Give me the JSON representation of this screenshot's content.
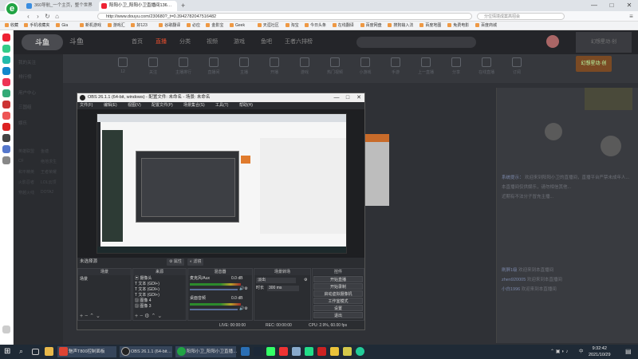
{
  "browser": {
    "tabs": [
      {
        "label": "360导航_一个主页，整个世界",
        "active": false
      },
      {
        "label": "阳阳小卫_阳阳小卫直播间136…",
        "active": true
      }
    ],
    "new_tab": "+",
    "url": "http://www.douyu.com/230680?_t=0.3942782047516482",
    "search_placeholder": "分位情境成案高招会",
    "window_controls": [
      "—",
      "□",
      "✕"
    ]
  },
  "bookmarks": [
    "收藏",
    "手机收藏夹",
    "Gia",
    "新机游戏",
    "游戏汇",
    "好123",
    "谷歌翻译",
    "必应",
    "金影宝",
    "Geek",
    "天涯社区",
    "淘宝",
    "今日头条",
    "在线翻译",
    "百度网盘",
    "搜狗输入法",
    "百度地图",
    "免费电影",
    "百度商城"
  ],
  "site": {
    "logo": "斗鱼",
    "logo2": "斗鱼",
    "nav": [
      "首页",
      "直播",
      "分类",
      "视频",
      "游戏",
      "鱼吧",
      "王者六排榜"
    ],
    "promo": "幻想星动·创",
    "left_nav": [
      "我的关注",
      "排行榜",
      "用户中心",
      "三国组",
      "娱乐",
      "鱼塘",
      "英雄联盟",
      "绝地求生",
      "CF",
      "王者荣耀",
      "和平精英",
      "LOL云顶",
      "火影忍者",
      "DOTA2",
      "穿越火线"
    ],
    "section_icons": [
      "12",
      "关注",
      "主播排行",
      "直播间",
      "主播",
      "开播",
      "游戏",
      "热门视频",
      "小游戏",
      "手游",
      "上一直播",
      "分享",
      "在线直播",
      "订阅"
    ],
    "chat": [
      {
        "user": "系统提示：",
        "text": "欢迎来到阳阳小卫的直播间，直播平台严禁未成年人..."
      },
      {
        "user": "",
        "text": "本直播间仅供娱乐，请勿相信其他..."
      },
      {
        "user": "",
        "text": "近期有不法分子冒充主播..."
      },
      {
        "user": "刷屏1级",
        "text": "欢迎来到本直播间"
      },
      {
        "user": "zhen920005",
        "text": "欢迎来到本直播间"
      },
      {
        "user": "小白1996",
        "text": "欢迎来到本直播间"
      }
    ]
  },
  "obs": {
    "title": "OBS 26.1.1 (64-bit, windows) - 配置文件: 未命名 - 场景: 未命名",
    "menu": [
      "文件(F)",
      "编辑(E)",
      "视图(V)",
      "配置文件(P)",
      "场景集合(S)",
      "工具(T)",
      "帮助(H)"
    ],
    "no_source": "未选择源",
    "props_btn": "属性",
    "filter_btn": "滤镜",
    "docks": {
      "scenes": {
        "title": "场景",
        "items": [
          "场景"
        ]
      },
      "sources": {
        "title": "来源",
        "items": [
          "摄像头",
          "文本 (GDI+)",
          "文本 (GDI+)",
          "文本 (GDI+)",
          "图像 4",
          "图像 3"
        ]
      },
      "mixer": {
        "title": "混音器",
        "tracks": [
          {
            "name": "麦克风/Aux",
            "db": "0.0 dB"
          },
          {
            "name": "桌面音频",
            "db": "0.0 dB"
          }
        ]
      },
      "transitions": {
        "title": "场景转场",
        "type": "淡出",
        "duration_label": "时长",
        "duration": "300 ms"
      },
      "controls": {
        "title": "控件",
        "buttons": [
          "开始直播",
          "开始录制",
          "启动虚拟摄像机",
          "工作室模式",
          "设置",
          "退出"
        ]
      }
    },
    "status": {
      "live": "LIVE: 00:00:00",
      "rec": "REC: 00:00:00",
      "cpu": "CPU: 2.9%, 60.00 fps"
    }
  },
  "taskbar": {
    "items": [
      "魅声T800控制面板",
      "OBS 26.1.1 (64-bit…",
      "阳阳小卫_阳阳小卫直播…"
    ],
    "time": "9:32:42",
    "date": "2021/10/29",
    "ime": "中"
  },
  "colors": {
    "accent": "#e94f2e",
    "taskbar": "#1f2a36",
    "obs_bg": "#2b2d31"
  }
}
